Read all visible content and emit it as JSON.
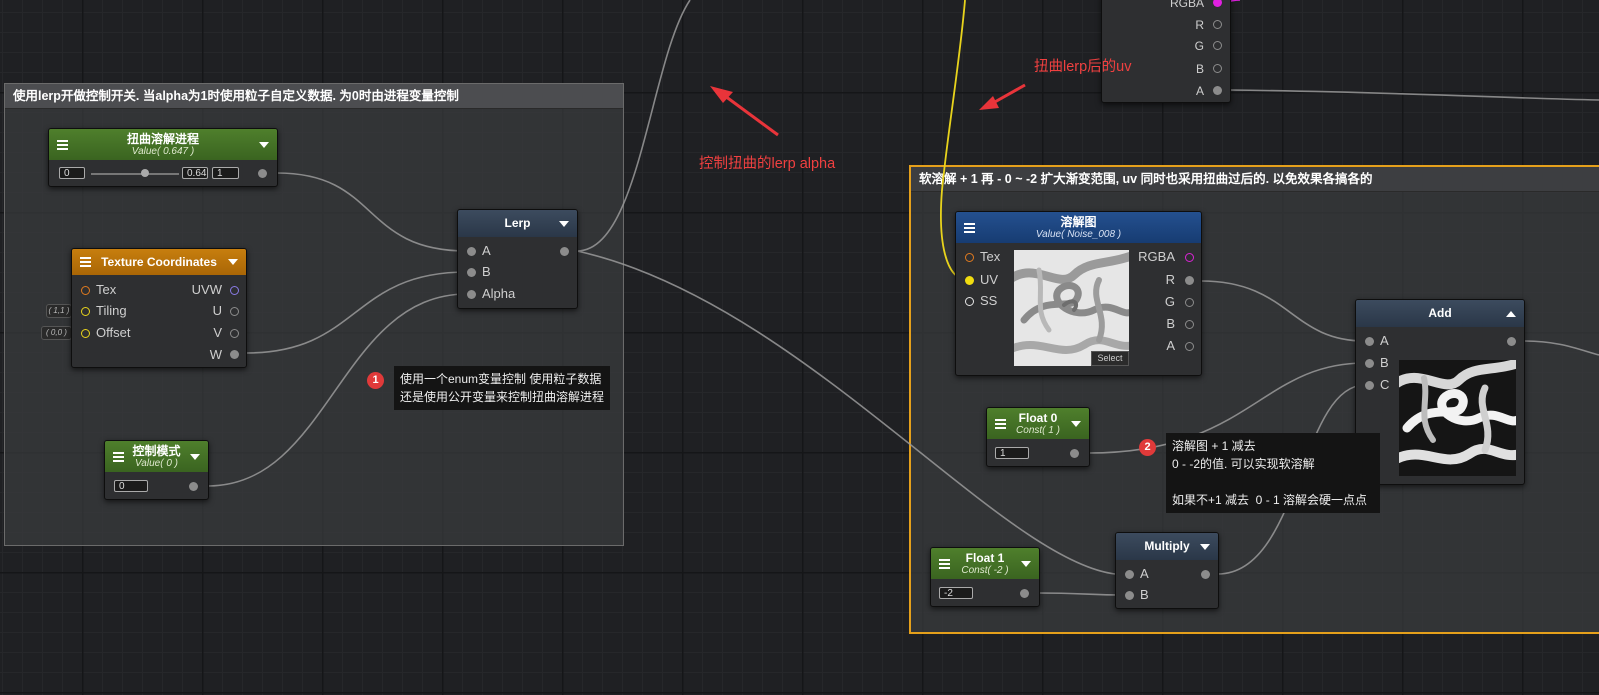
{
  "groups": {
    "left": {
      "title": "使用lerp开做控制开关. 当alpha为1时使用粒子自定义数据. 为0时由进程变量控制"
    },
    "right": {
      "title": "软溶解 + 1 再  - 0 ~ -2 扩大渐变范围, uv 同时也采用扭曲过后的. 以免效果各搞各的"
    }
  },
  "nodes": {
    "distort_progress": {
      "title": "扭曲溶解进程",
      "subtitle": "Value( 0.647 )",
      "min": "0",
      "value": "0.64",
      "max": "1"
    },
    "texcoord": {
      "title": "Texture Coordinates",
      "tex": "Tex",
      "tiling": "Tiling",
      "offset": "Offset",
      "uvw": "UVW",
      "u": "U",
      "v": "V",
      "w": "W",
      "tiling_value": "( 1,1 )",
      "offset_value": "( 0,0 )"
    },
    "lerp": {
      "title": "Lerp",
      "a": "A",
      "b": "B",
      "alpha": "Alpha"
    },
    "control_mode": {
      "title": "控制模式",
      "subtitle": "Value( 0 )",
      "value": "0"
    },
    "top_sampler": {
      "rgba": "RGBA",
      "r": "R",
      "g": "G",
      "b": "B",
      "a": "A"
    },
    "dissolve_tex": {
      "title": "溶解图",
      "subtitle": "Value( Noise_008 )",
      "tex": "Tex",
      "uv": "UV",
      "ss": "SS",
      "rgba": "RGBA",
      "r": "R",
      "g": "G",
      "b": "B",
      "a": "A",
      "select": "Select"
    },
    "float0": {
      "title": "Float 0",
      "subtitle": "Const( 1 )",
      "value": "1"
    },
    "float1": {
      "title": "Float 1",
      "subtitle": "Const( -2 )",
      "value": "-2"
    },
    "multiply": {
      "title": "Multiply",
      "a": "A",
      "b": "B"
    },
    "add": {
      "title": "Add",
      "a": "A",
      "b": "B",
      "c": "C"
    }
  },
  "notes": {
    "note1": {
      "badge": "1",
      "text": "使用一个enum变量控制 使用粒子数据\n还是使用公开变量来控制扭曲溶解进程"
    },
    "note2": {
      "badge": "2",
      "text": "溶解图 + 1 减去\n0 - -2的值. 可以实现软溶解\n\n如果不+1 减去  0 - 1 溶解会硬一点点"
    }
  },
  "annotations": {
    "lerp_alpha": "控制扭曲的lerp alpha",
    "distorted_uv": "扭曲lerp后的uv"
  },
  "colors": {
    "group_border_orange": "#e5a01b",
    "annotation_red": "#f04040",
    "header_green": "#4f7f2c",
    "header_blue": "#24508f",
    "header_orange": "#c77e0e",
    "wire_yellow": "#e8d31c"
  }
}
